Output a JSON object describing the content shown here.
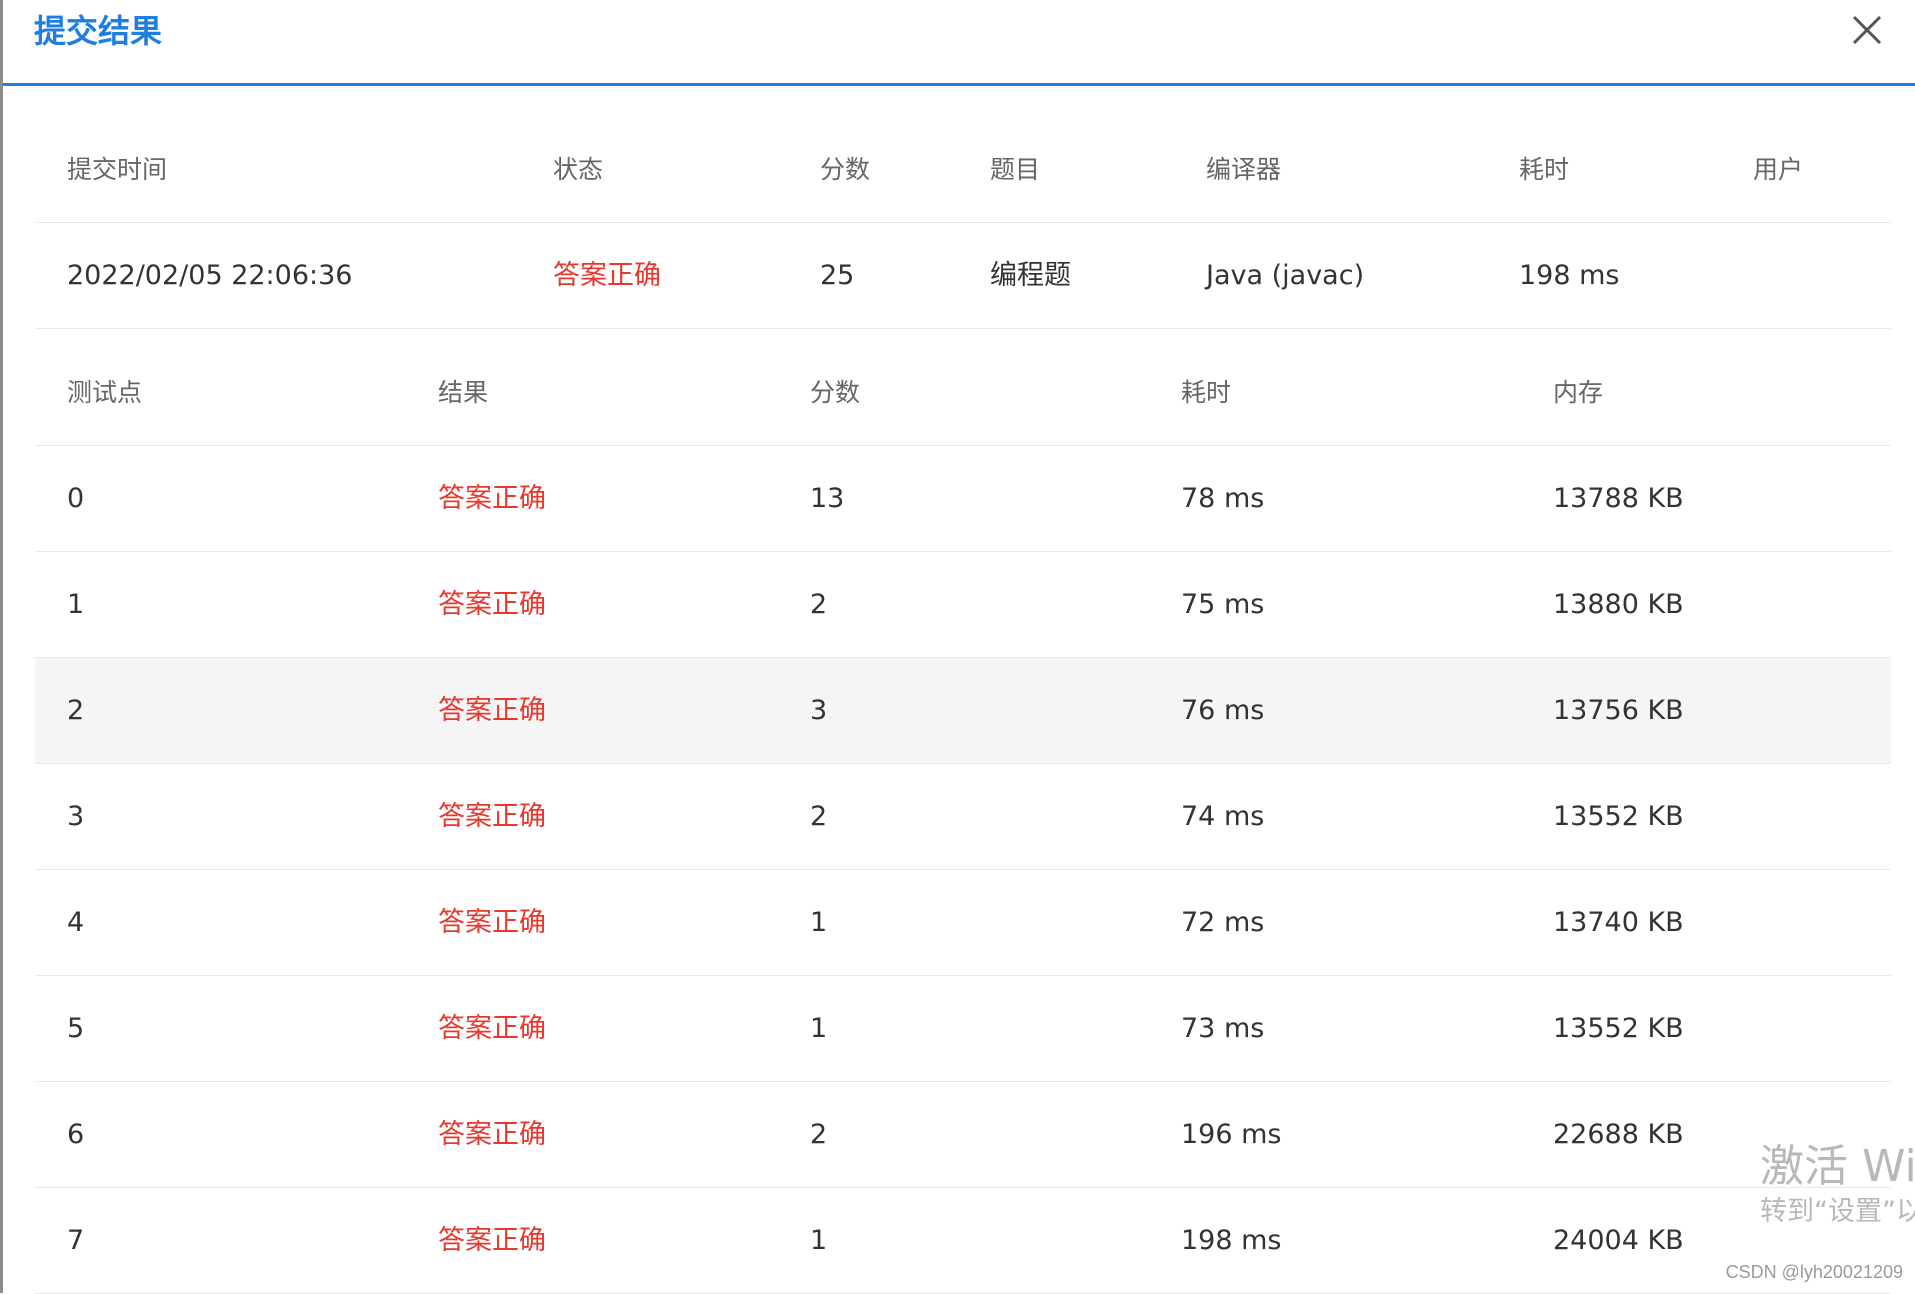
{
  "dialog": {
    "title": "提交结果",
    "close_icon": "close-icon"
  },
  "submission": {
    "headers": {
      "time": "提交时间",
      "status": "状态",
      "score": "分数",
      "problem": "题目",
      "compiler": "编译器",
      "cost": "耗时",
      "user": "用户"
    },
    "row": {
      "time": "2022/02/05 22:06:36",
      "status": "答案正确",
      "score": "25",
      "problem": "编程题",
      "compiler": "Java (javac)",
      "cost": "198 ms",
      "user": ""
    }
  },
  "cases": {
    "headers": {
      "case": "测试点",
      "result": "结果",
      "score": "分数",
      "time": "耗时",
      "memory": "内存"
    },
    "rows": [
      {
        "case": "0",
        "result": "答案正确",
        "score": "13",
        "time": "78 ms",
        "memory": "13788 KB"
      },
      {
        "case": "1",
        "result": "答案正确",
        "score": "2",
        "time": "75 ms",
        "memory": "13880 KB"
      },
      {
        "case": "2",
        "result": "答案正确",
        "score": "3",
        "time": "76 ms",
        "memory": "13756 KB"
      },
      {
        "case": "3",
        "result": "答案正确",
        "score": "2",
        "time": "74 ms",
        "memory": "13552 KB"
      },
      {
        "case": "4",
        "result": "答案正确",
        "score": "1",
        "time": "72 ms",
        "memory": "13740 KB"
      },
      {
        "case": "5",
        "result": "答案正确",
        "score": "1",
        "time": "73 ms",
        "memory": "13552 KB"
      },
      {
        "case": "6",
        "result": "答案正确",
        "score": "2",
        "time": "196 ms",
        "memory": "22688 KB"
      },
      {
        "case": "7",
        "result": "答案正确",
        "score": "1",
        "time": "198 ms",
        "memory": "24004 KB"
      }
    ]
  },
  "colors": {
    "accent": "#1f7fe0",
    "status_ok": "#e8372d"
  },
  "overlay": {
    "activate_line1": "激活 Wir",
    "activate_line2": "转到“设置”以",
    "csdn": "CSDN @lyh20021209"
  }
}
